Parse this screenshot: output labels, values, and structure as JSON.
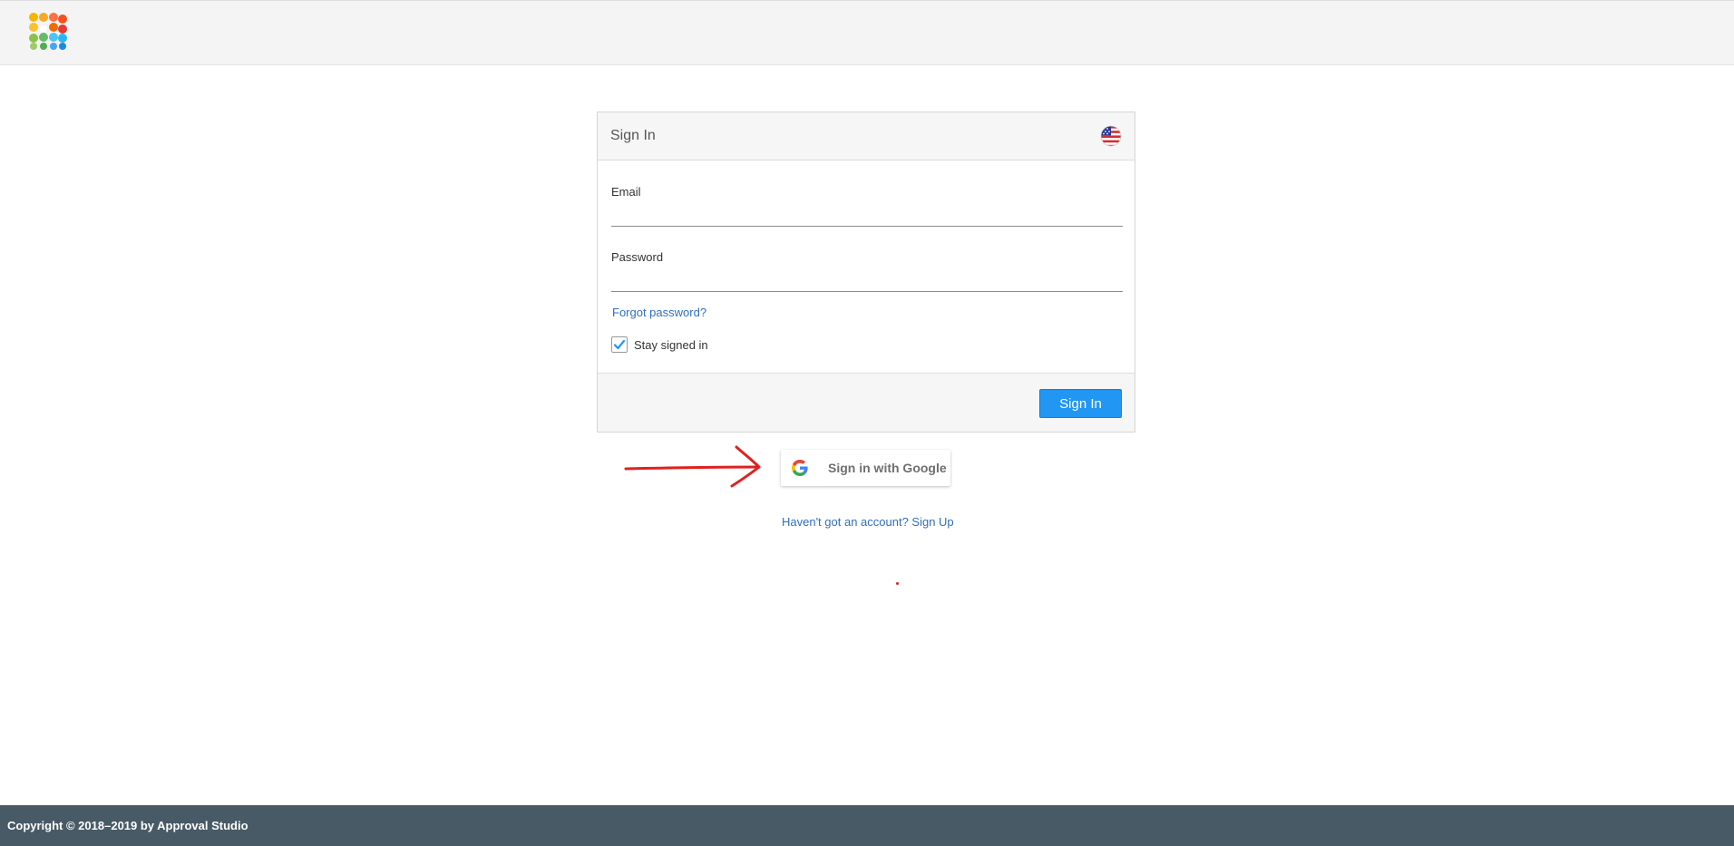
{
  "header": {
    "logo_icon": "app-logo-icon"
  },
  "signin_card": {
    "title": "Sign In",
    "language_icon": "us-flag-icon",
    "email": {
      "label": "Email",
      "value": "",
      "placeholder": ""
    },
    "password": {
      "label": "Password",
      "value": "",
      "placeholder": ""
    },
    "forgot_password": "Forgot password?",
    "stay_signed_in": {
      "label": "Stay signed in",
      "checked": true
    },
    "submit_label": "Sign In"
  },
  "google_signin": {
    "label": "Sign in with Google",
    "icon": "google-g-icon"
  },
  "signup_link": "Haven't got an account? Sign Up",
  "footer": {
    "copyright": "Copyright © 2018–2019 by Approval Studio"
  },
  "colors": {
    "primary_button": "#2196f3",
    "link": "#2f6fbd",
    "footer_bg": "#485a66",
    "annotation_arrow": "#e02020"
  }
}
